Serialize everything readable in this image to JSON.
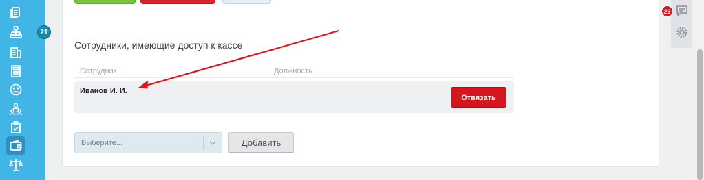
{
  "sidebar": {
    "badge": "21",
    "items": [
      {
        "icon": "documents-icon"
      },
      {
        "icon": "hierarchy-icon"
      },
      {
        "icon": "building-icon"
      },
      {
        "icon": "calculator-icon"
      },
      {
        "icon": "sad-face-icon"
      },
      {
        "icon": "users-icon"
      },
      {
        "icon": "clipboard-check-icon"
      },
      {
        "icon": "wallet-icon",
        "active": true
      },
      {
        "icon": "scales-icon"
      }
    ]
  },
  "section": {
    "title": "Сотрудники, имеющие доступ к кассе",
    "columns": {
      "employee": "Сотрудник",
      "position": "Должность"
    },
    "rows": [
      {
        "name": "Иванов И. И.",
        "position": "",
        "unbind_label": "Отвязать"
      }
    ]
  },
  "add_form": {
    "select_placeholder": "Выберите...",
    "add_label": "Добавить"
  },
  "right_panel": {
    "notification_count": "29",
    "icons": [
      "chat-icon",
      "settings-icon"
    ]
  },
  "colors": {
    "sidebar": "#41b6e6",
    "danger": "#d4161f",
    "success": "#7cc242",
    "arrow": "#e3131b"
  }
}
